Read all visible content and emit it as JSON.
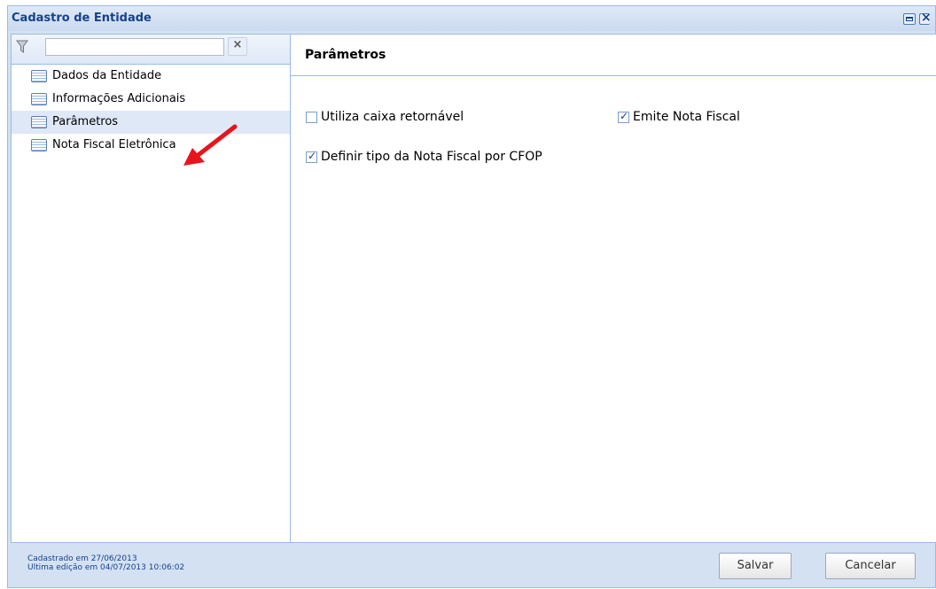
{
  "window": {
    "title": "Cadastro de Entidade"
  },
  "icons": {
    "maximize": "maximize-icon",
    "close": "close-icon",
    "filter": "funnel-icon",
    "clear": "clear-icon",
    "document": "list-document-icon",
    "annotation": "red-arrow"
  },
  "filter": {
    "value": "",
    "clear_label": "×"
  },
  "tree": {
    "items": [
      {
        "label": "Dados da Entidade"
      },
      {
        "label": "Informações Adicionais"
      },
      {
        "label": "Parâmetros"
      },
      {
        "label": "Nota Fiscal Eletrônica"
      }
    ],
    "selected_index": 2
  },
  "form": {
    "title": "Parâmetros",
    "checkboxes": [
      {
        "label": "Utiliza caixa retornável",
        "checked": false
      },
      {
        "label": "Emite Nota Fiscal",
        "checked": true
      },
      {
        "label": "Definir tipo da Nota Fiscal por CFOP",
        "checked": true
      }
    ]
  },
  "footer": {
    "created": "Cadastrado em 27/06/2013",
    "edited": "Ultima edição em 04/07/2013 10:06:02",
    "save_label": "Salvar",
    "cancel_label": "Cancelar"
  },
  "colors": {
    "accent": "#15428b",
    "border": "#99bbe8",
    "selection": "#dfe8f6",
    "annotation": "#e8141b"
  }
}
